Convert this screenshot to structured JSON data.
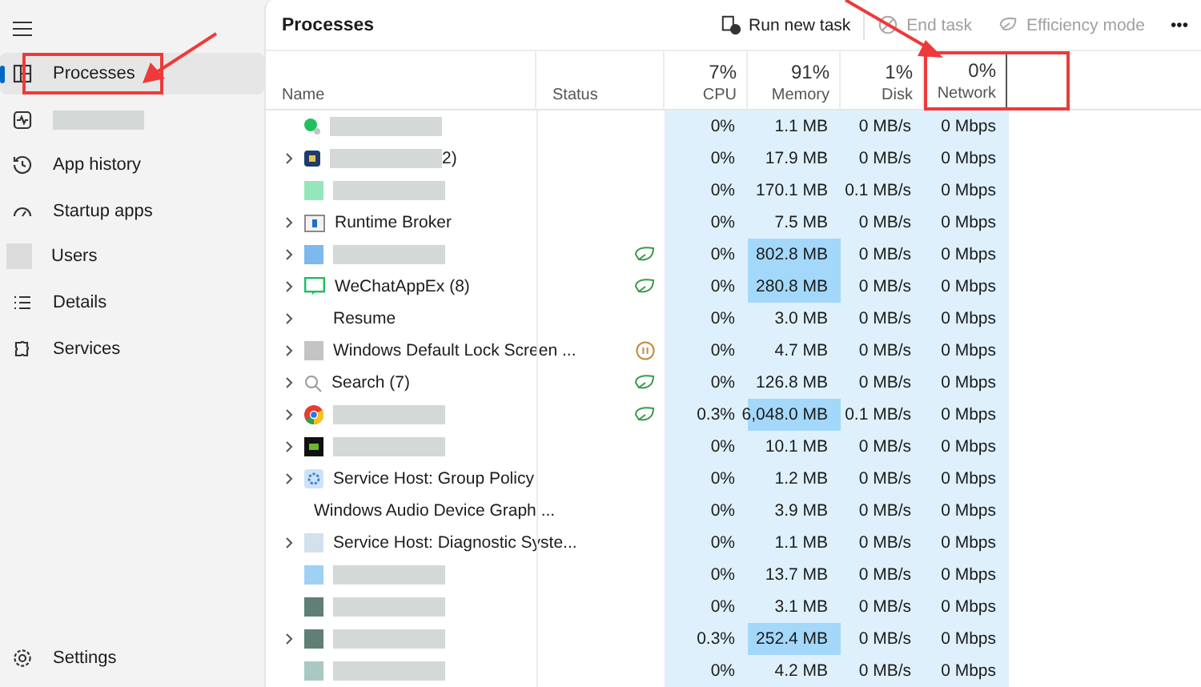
{
  "sidebar": {
    "items": [
      {
        "label": "Processes",
        "selected": true,
        "highlighted": true
      },
      {
        "redacted": true,
        "selected": false
      },
      {
        "label": "App history",
        "selected": false
      },
      {
        "label": "Startup apps",
        "selected": false
      },
      {
        "label": "Users",
        "selected": false
      },
      {
        "label": "Details",
        "selected": false
      },
      {
        "label": "Services",
        "selected": false
      }
    ],
    "footer": {
      "label": "Settings"
    }
  },
  "page_title": "Processes",
  "toolbar": [
    {
      "label": "Run new task",
      "disabled": false
    },
    {
      "label": "End task",
      "disabled": true
    },
    {
      "label": "Efficiency mode",
      "disabled": true
    },
    {
      "label": "•••",
      "disabled": false
    }
  ],
  "columns": [
    {
      "label": "Name",
      "kind": "text"
    },
    {
      "label": "Status",
      "kind": "text"
    },
    {
      "label": "CPU",
      "total": "7%",
      "kind": "metric"
    },
    {
      "label": "Memory",
      "total": "91%",
      "kind": "metric"
    },
    {
      "label": "Disk",
      "total": "1%",
      "kind": "metric"
    },
    {
      "label": "Network",
      "total": "0%",
      "kind": "metric",
      "highlighted": true
    }
  ],
  "rows": [
    {
      "expandable": false,
      "redacted": true,
      "cpu": "0%",
      "memory": "1.1 MB",
      "disk": "0 MB/s",
      "network": "0 Mbps"
    },
    {
      "expandable": true,
      "redacted": true,
      "name": "2)",
      "cpu": "0%",
      "memory": "17.9 MB",
      "disk": "0 MB/s",
      "network": "0 Mbps"
    },
    {
      "expandable": false,
      "redacted": true,
      "cpu": "0%",
      "memory": "170.1 MB",
      "disk": "0.1 MB/s",
      "network": "0 Mbps"
    },
    {
      "expandable": true,
      "name": "Runtime Broker",
      "cpu": "0%",
      "memory": "7.5 MB",
      "disk": "0 MB/s",
      "network": "0 Mbps"
    },
    {
      "expandable": true,
      "redacted": true,
      "efficiency": true,
      "memory_highlighted": true,
      "cpu": "0%",
      "memory": "802.8 MB",
      "disk": "0 MB/s",
      "network": "0 Mbps"
    },
    {
      "expandable": true,
      "name": "WeChatAppEx (8)",
      "efficiency": true,
      "memory_highlighted": true,
      "cpu": "0%",
      "memory": "280.8 MB",
      "disk": "0 MB/s",
      "network": "0 Mbps"
    },
    {
      "expandable": true,
      "name": "Resume",
      "cpu": "0%",
      "memory": "3.0 MB",
      "disk": "0 MB/s",
      "network": "0 Mbps"
    },
    {
      "expandable": true,
      "name": "Windows Default Lock Screen ...",
      "paused": true,
      "cpu": "0%",
      "memory": "4.7 MB",
      "disk": "0 MB/s",
      "network": "0 Mbps"
    },
    {
      "expandable": true,
      "name": "Search (7)",
      "efficiency": true,
      "cpu": "0%",
      "memory": "126.8 MB",
      "disk": "0 MB/s",
      "network": "0 Mbps"
    },
    {
      "expandable": true,
      "redacted": true,
      "efficiency": true,
      "memory_highlighted": true,
      "cpu": "0.3%",
      "memory": "6,048.0 MB",
      "disk": "0.1 MB/s",
      "network": "0 Mbps"
    },
    {
      "expandable": true,
      "redacted": true,
      "cpu": "0%",
      "memory": "10.1 MB",
      "disk": "0 MB/s",
      "network": "0 Mbps"
    },
    {
      "expandable": true,
      "name": "Service Host: Group Policy",
      "cpu": "0%",
      "memory": "1.2 MB",
      "disk": "0 MB/s",
      "network": "0 Mbps"
    },
    {
      "expandable": false,
      "name": "Windows Audio Device Graph ...",
      "cpu": "0%",
      "memory": "3.9 MB",
      "disk": "0 MB/s",
      "network": "0 Mbps"
    },
    {
      "expandable": true,
      "name": "Service Host: Diagnostic Syste...",
      "cpu": "0%",
      "memory": "1.1 MB",
      "disk": "0 MB/s",
      "network": "0 Mbps"
    },
    {
      "expandable": false,
      "redacted": true,
      "cpu": "0%",
      "memory": "13.7 MB",
      "disk": "0 MB/s",
      "network": "0 Mbps"
    },
    {
      "expandable": false,
      "redacted": true,
      "cpu": "0%",
      "memory": "3.1 MB",
      "disk": "0 MB/s",
      "network": "0 Mbps"
    },
    {
      "expandable": true,
      "redacted": true,
      "memory_highlighted": true,
      "cpu": "0.3%",
      "memory": "252.4 MB",
      "disk": "0 MB/s",
      "network": "0 Mbps"
    },
    {
      "expandable": false,
      "redacted": true,
      "cpu": "0%",
      "memory": "4.2 MB",
      "disk": "0 MB/s",
      "network": "0 Mbps"
    }
  ]
}
